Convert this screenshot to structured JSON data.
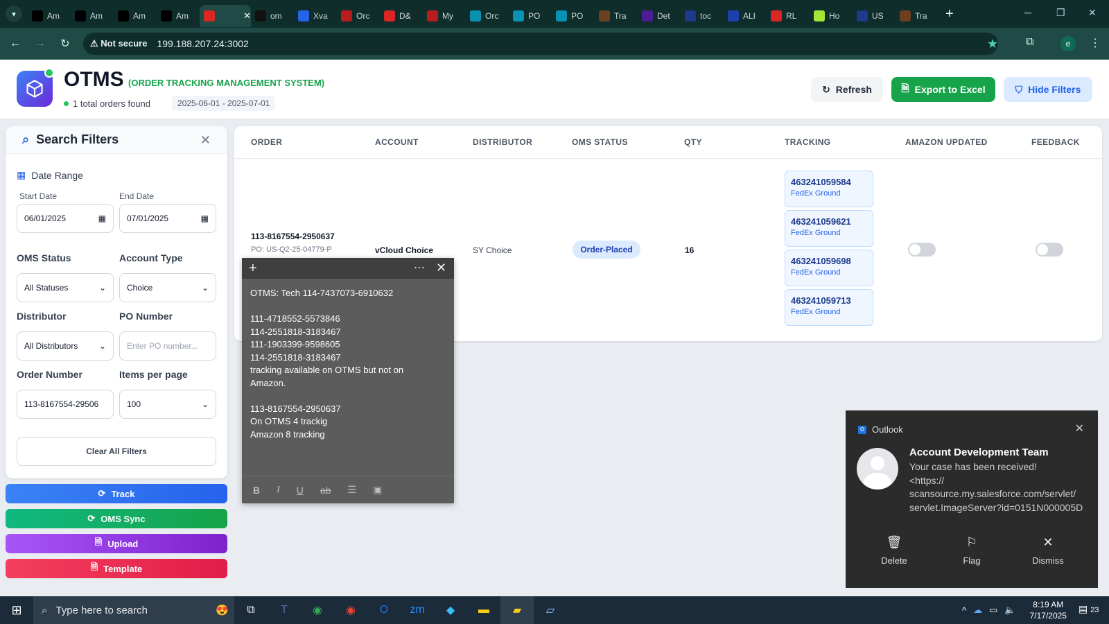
{
  "browser": {
    "tabs": [
      {
        "label": "Am",
        "icon": "amazon-icon",
        "color": "#000000"
      },
      {
        "label": "Am",
        "icon": "amazon-icon",
        "color": "#000000"
      },
      {
        "label": "Am",
        "icon": "amazon-icon",
        "color": "#000000"
      },
      {
        "label": "Am",
        "icon": "amazon-icon",
        "color": "#000000"
      },
      {
        "label": "",
        "icon": "app-icon",
        "color": "#dc2626",
        "active": true
      },
      {
        "label": "om",
        "icon": "triangle-icon",
        "color": "#111111"
      },
      {
        "label": "Xva",
        "icon": "xva-icon",
        "color": "#2563eb"
      },
      {
        "label": "Orc",
        "icon": "orc-icon",
        "color": "#b91c1c"
      },
      {
        "label": "D&",
        "icon": "dh-icon",
        "color": "#dc2626"
      },
      {
        "label": "My",
        "icon": "my-icon",
        "color": "#b91c1c"
      },
      {
        "label": "Orc",
        "icon": "ec-icon",
        "color": "#0891b2"
      },
      {
        "label": "PO",
        "icon": "ec-icon",
        "color": "#0891b2"
      },
      {
        "label": "PO",
        "icon": "ec-icon",
        "color": "#0891b2"
      },
      {
        "label": "Tra",
        "icon": "ups-icon",
        "color": "#6b3f1f"
      },
      {
        "label": "Det",
        "icon": "fedex-icon",
        "color": "#4c1d95"
      },
      {
        "label": "toc",
        "icon": "mail-icon",
        "color": "#1e3a8a"
      },
      {
        "label": "ALI",
        "icon": "17track-icon",
        "color": "#1e40af"
      },
      {
        "label": "RL",
        "icon": "rl-icon",
        "color": "#dc2626"
      },
      {
        "label": "Ho",
        "icon": "ho-icon",
        "color": "#a3e635"
      },
      {
        "label": "US",
        "icon": "mail-icon",
        "color": "#1e3a8a"
      },
      {
        "label": "Tra",
        "icon": "ups-icon",
        "color": "#6b3f1f"
      }
    ],
    "not_secure": "Not secure",
    "url": "199.188.207.24:3002",
    "profile_initial": "e"
  },
  "header": {
    "title": "OTMS",
    "subtitle": "(ORDER TRACKING MANAGEMENT SYSTEM)",
    "orders_found": "1 total orders found",
    "date_range": "2025-06-01 - 2025-07-01",
    "refresh_label": "Refresh",
    "export_label": "Export to Excel",
    "hide_filters_label": "Hide Filters"
  },
  "filters": {
    "title": "Search Filters",
    "date_range_label": "Date Range",
    "start_date_label": "Start Date",
    "start_date": "06/01/2025",
    "end_date_label": "End Date",
    "end_date": "07/01/2025",
    "oms_status_label": "OMS Status",
    "oms_status_value": "All Statuses",
    "account_type_label": "Account Type",
    "account_type_value": "Choice",
    "distributor_label": "Distributor",
    "distributor_value": "All Distributors",
    "po_number_label": "PO Number",
    "po_number_placeholder": "Enter PO number...",
    "order_number_label": "Order Number",
    "order_number_value": "113-8167554-29506",
    "items_per_page_label": "Items per page",
    "items_per_page_value": "100",
    "clear_label": "Clear All Filters"
  },
  "actions": {
    "track": "Track",
    "oms_sync": "OMS Sync",
    "upload": "Upload",
    "template": "Template"
  },
  "table": {
    "columns": [
      "ORDER",
      "ACCOUNT",
      "DISTRIBUTOR",
      "OMS STATUS",
      "QTY",
      "TRACKING",
      "AMAZON UPDATED",
      "FEEDBACK"
    ],
    "row": {
      "order": "113-8167554-2950637",
      "po": "PO: US-Q2-25-04779-P",
      "account": "vCloud Choice",
      "distributor": "SY Choice",
      "status": "Order-Placed",
      "qty": "16",
      "tracking": [
        {
          "number": "463241059584",
          "carrier": "FedEx Ground"
        },
        {
          "number": "463241059621",
          "carrier": "FedEx Ground"
        },
        {
          "number": "463241059698",
          "carrier": "FedEx Ground"
        },
        {
          "number": "463241059713",
          "carrier": "FedEx Ground"
        }
      ],
      "amazon_updated": false,
      "feedback": false
    }
  },
  "sticky_note": {
    "lines": [
      "OTMS: Tech 114-7437073-6910632",
      "",
      "111-4718552-5573846",
      "114-2551818-3183467",
      "111-1903399-9598605",
      "114-2551818-3183467",
      "tracking available on OTMS but not on",
      "Amazon.",
      "",
      "113-8167554-2950637",
      "On OTMS 4 trackig",
      "Amazon 8 tracking"
    ]
  },
  "toast": {
    "app": "Outlook",
    "from": "Account Development Team",
    "message_lines": [
      "Your case has been received!",
      "<https://",
      "scansource.my.salesforce.com/servlet/",
      "servlet.ImageServer?id=0151N000005D"
    ],
    "delete": "Delete",
    "flag": "Flag",
    "dismiss": "Dismiss"
  },
  "taskbar": {
    "search_placeholder": "Type here to search",
    "time": "8:19 AM",
    "date": "7/17/2025",
    "notifications": "23"
  }
}
